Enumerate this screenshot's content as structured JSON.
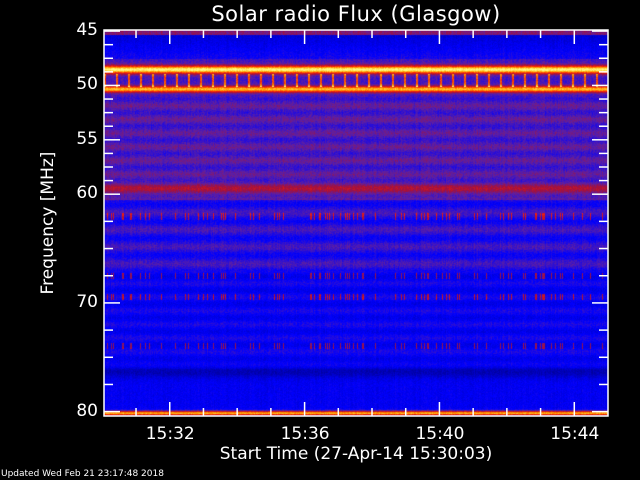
{
  "chart_data": {
    "type": "heatmap",
    "title": "Solar radio Flux (Glasgow)",
    "xlabel": "Start Time (27-Apr-14 15:30:03)",
    "ylabel": "Frequency [MHz]",
    "x_range": [
      "15:30:03",
      "15:45:00"
    ],
    "y_range": [
      44.9,
      80.4
    ],
    "y_inverted": true,
    "x_ticks": [
      "15:32",
      "15:36",
      "15:40",
      "15:44"
    ],
    "y_ticks": [
      45,
      50,
      55,
      60,
      70,
      80
    ],
    "colormap": [
      "#000060",
      "#0000ff",
      "#6020a0",
      "#a01040",
      "#ff2000",
      "#ffa000",
      "#ffff80"
    ],
    "bright_bands_mhz": [
      48.5,
      50.3,
      80.0
    ],
    "interference_bands_mhz": [
      62.0,
      67.5,
      69.4,
      73.9
    ]
  },
  "footer": {
    "updated": "Updated Wed Feb 21 23:17:48 2018"
  }
}
